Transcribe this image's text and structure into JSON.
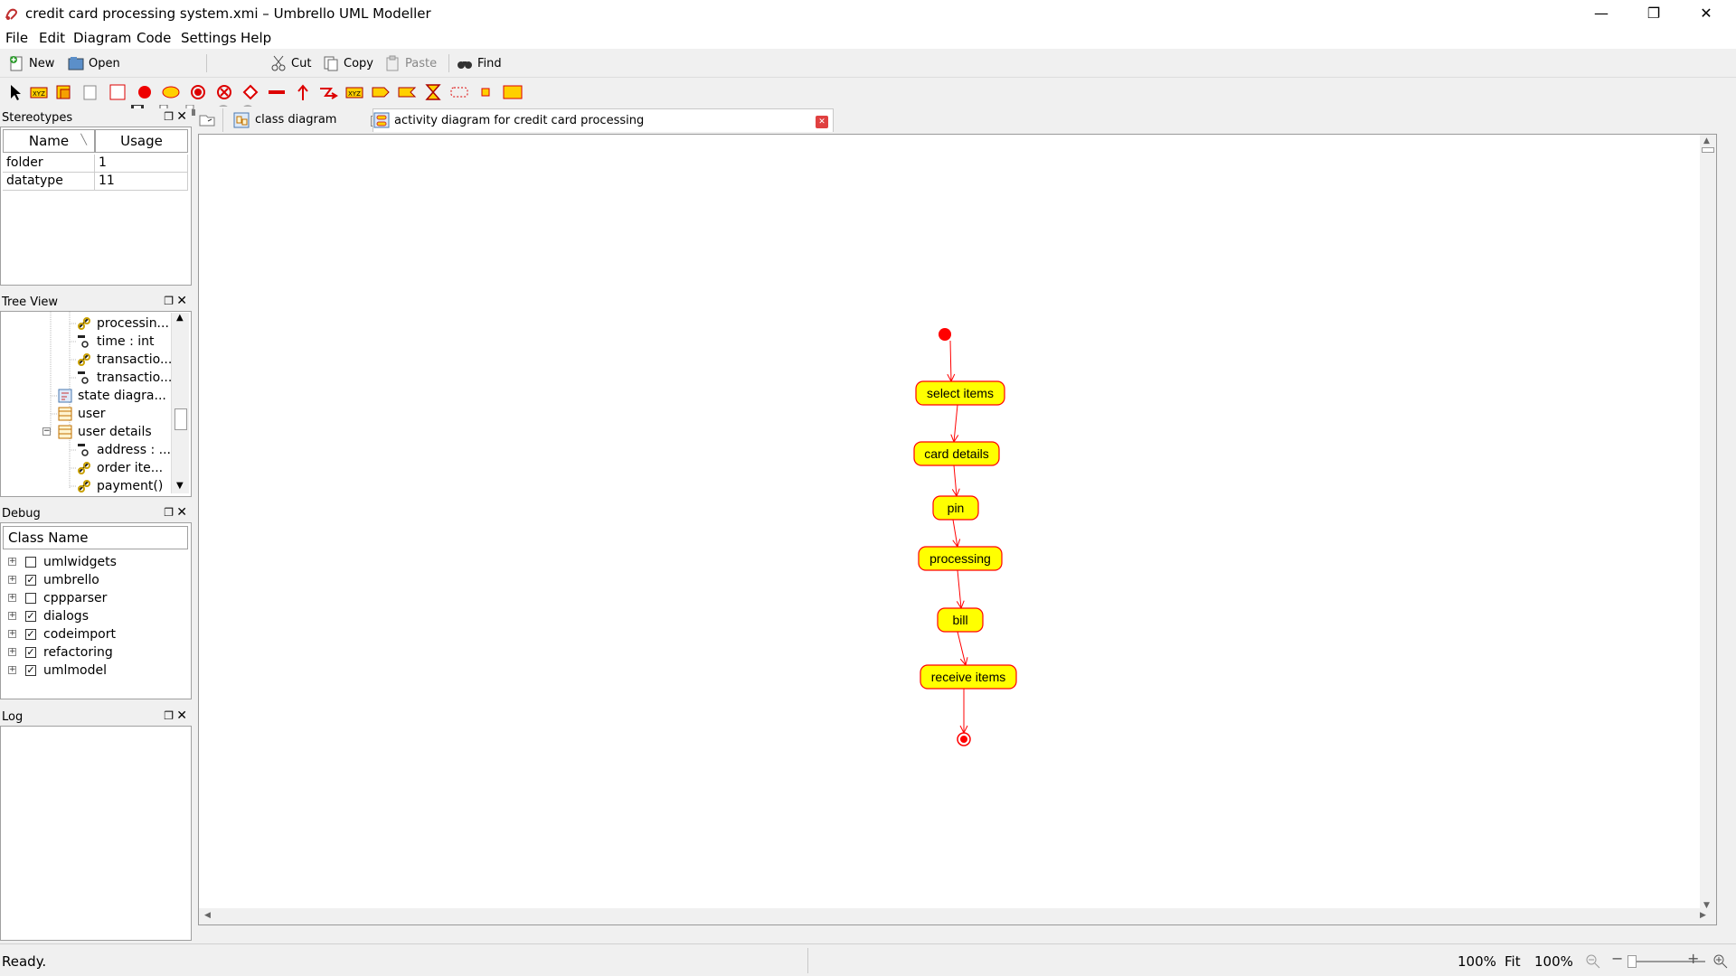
{
  "window": {
    "title": "credit card processing system.xmi – Umbrello UML Modeller",
    "minimize": "—",
    "maximize": "❐",
    "close": "✕"
  },
  "menu": [
    "File",
    "Edit",
    "Diagram",
    "Code",
    "Settings",
    "Help"
  ],
  "toolbar": {
    "new": "New",
    "open": "Open",
    "cut": "Cut",
    "copy": "Copy",
    "paste": "Paste",
    "find": "Find"
  },
  "stereotypes": {
    "title": "Stereotypes",
    "col_name": "Name",
    "col_usage": "Usage",
    "rows": [
      {
        "name": "folder",
        "usage": "1"
      },
      {
        "name": "datatype",
        "usage": "11"
      }
    ]
  },
  "treeview": {
    "title": "Tree View",
    "items": [
      {
        "label": "processin...",
        "icon": "operation-icon"
      },
      {
        "label": "time : int",
        "icon": "attribute-icon"
      },
      {
        "label": "transactio...",
        "icon": "operation-icon"
      },
      {
        "label": "transactio...",
        "icon": "attribute-icon"
      },
      {
        "label": "state diagra...",
        "icon": "state-diagram-icon"
      },
      {
        "label": "user",
        "icon": "class-icon"
      },
      {
        "label": "user details",
        "icon": "class-icon"
      },
      {
        "label": "address : ...",
        "icon": "attribute-icon"
      },
      {
        "label": "order ite...",
        "icon": "operation-icon"
      },
      {
        "label": "payment()",
        "icon": "operation-icon"
      }
    ]
  },
  "debug": {
    "title": "Debug",
    "col": "Class Name",
    "rows": [
      {
        "name": "umlwidgets",
        "checked": false
      },
      {
        "name": "umbrello",
        "checked": true
      },
      {
        "name": "cppparser",
        "checked": false
      },
      {
        "name": "dialogs",
        "checked": true
      },
      {
        "name": "codeimport",
        "checked": true
      },
      {
        "name": "refactoring",
        "checked": true
      },
      {
        "name": "umlmodel",
        "checked": true
      }
    ]
  },
  "log": {
    "title": "Log"
  },
  "tabs": [
    {
      "label": "class diagram",
      "active": false
    },
    {
      "label": "activity diagram for credit card processing",
      "active": true
    }
  ],
  "diagram": {
    "activities": [
      "select items",
      "card details",
      "pin",
      "processing",
      "bill",
      "receive items"
    ],
    "fill": "#ffff00",
    "stroke": "#ff0000"
  },
  "status": {
    "text": "Ready.",
    "zoom1": "100%",
    "fit": "Fit",
    "zoom2": "100%"
  }
}
